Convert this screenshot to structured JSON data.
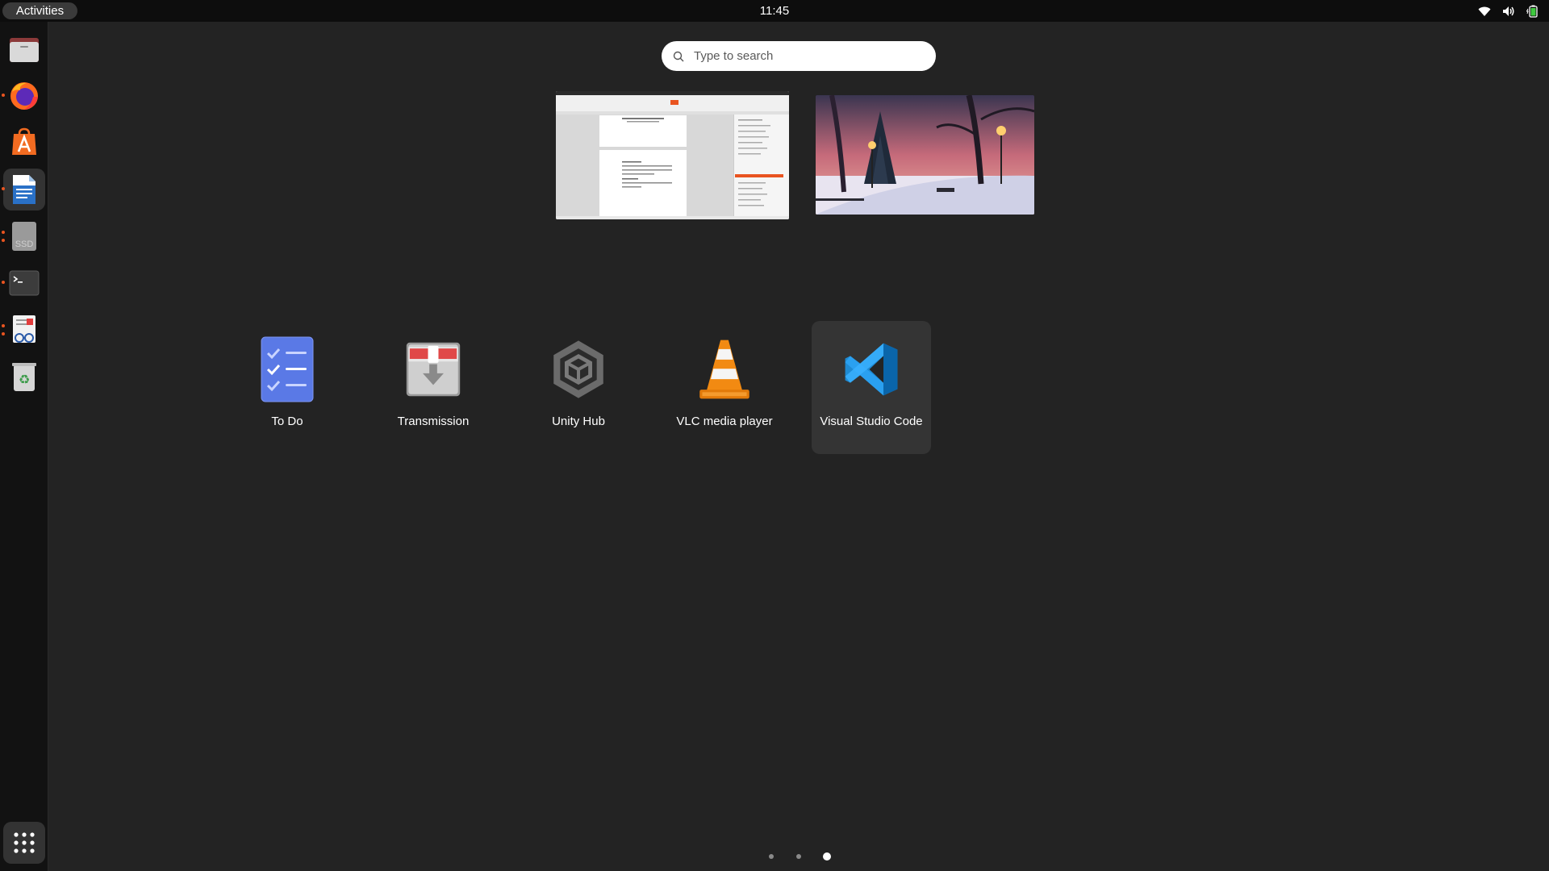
{
  "topbar": {
    "activities_label": "Activities",
    "clock": "11:45",
    "tray_icons": [
      "wifi-icon",
      "volume-icon",
      "battery-icon"
    ]
  },
  "dock": {
    "items": [
      {
        "name": "files",
        "icon": "files-icon",
        "running": false,
        "active": false
      },
      {
        "name": "firefox",
        "icon": "firefox-icon",
        "running": true,
        "active": false
      },
      {
        "name": "app-center",
        "icon": "app-center-icon",
        "running": false,
        "active": false
      },
      {
        "name": "libreoffice-writer",
        "icon": "writer-icon",
        "running": true,
        "active": true
      },
      {
        "name": "ssd",
        "icon": "ssd-drive-icon",
        "running": true,
        "active": false
      },
      {
        "name": "terminal",
        "icon": "terminal-icon",
        "running": true,
        "active": false
      },
      {
        "name": "document-viewer",
        "icon": "document-viewer-icon",
        "running": true,
        "active": false
      },
      {
        "name": "trash",
        "icon": "trash-icon",
        "running": false,
        "active": false
      }
    ],
    "show_apps_icon": "app-grid-icon"
  },
  "search": {
    "placeholder": "Type to search",
    "icon": "search-icon"
  },
  "apps": [
    {
      "label": "To Do",
      "icon": "todo-icon"
    },
    {
      "label": "Transmission",
      "icon": "transmission-icon"
    },
    {
      "label": "Unity Hub",
      "icon": "unity-hub-icon"
    },
    {
      "label": "VLC media player",
      "icon": "vlc-icon"
    },
    {
      "label": "Visual Studio Code",
      "icon": "vscode-icon"
    }
  ],
  "pager": {
    "pages": 3,
    "current": 3
  },
  "colors": {
    "background": "#232323",
    "topbar": "#0d0d0d",
    "dock": "#121212",
    "accent": "#e95420"
  }
}
